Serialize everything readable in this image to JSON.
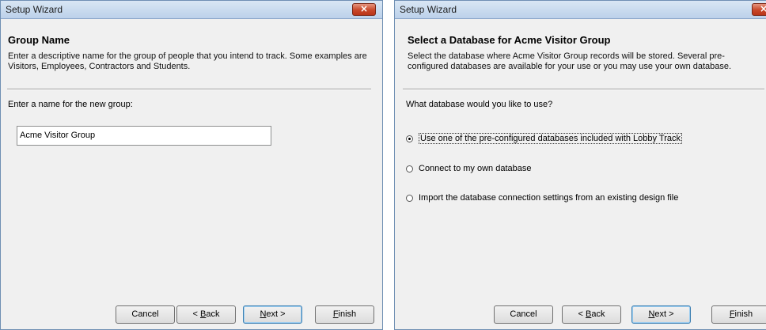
{
  "window1": {
    "title": "Setup Wizard",
    "close_label": "×",
    "heading": "Group Name",
    "description": "Enter a descriptive name for the group of people that you intend to track. Some examples are Visitors, Employees, Contractors and Students.",
    "prompt": "Enter a name for the new group:",
    "group_name_value": "Acme Visitor Group",
    "buttons": {
      "cancel": "Cancel",
      "back_prefix": "< ",
      "back_mnemonic": "B",
      "back_rest": "ack",
      "next_mnemonic": "N",
      "next_rest": "ext >",
      "finish_mnemonic": "F",
      "finish_rest": "inish"
    }
  },
  "window2": {
    "title": "Setup Wizard",
    "close_label": "×",
    "heading": "Select a Database for Acme Visitor Group",
    "description": "Select the database where Acme Visitor Group records will be stored. Several pre-configured databases are available for your use or you may use your own database.",
    "prompt": "What database would you like to use?",
    "options": [
      {
        "label": "Use one of the pre-configured databases included with Lobby Track",
        "selected": true
      },
      {
        "label": "Connect to my own database",
        "selected": false
      },
      {
        "label": "Import the database connection settings from an existing design file",
        "selected": false
      }
    ],
    "buttons": {
      "cancel": "Cancel",
      "back_prefix": "< ",
      "back_mnemonic": "B",
      "back_rest": "ack",
      "next_mnemonic": "N",
      "next_rest": "ext >",
      "finish_mnemonic": "F",
      "finish_rest": "inish"
    }
  }
}
